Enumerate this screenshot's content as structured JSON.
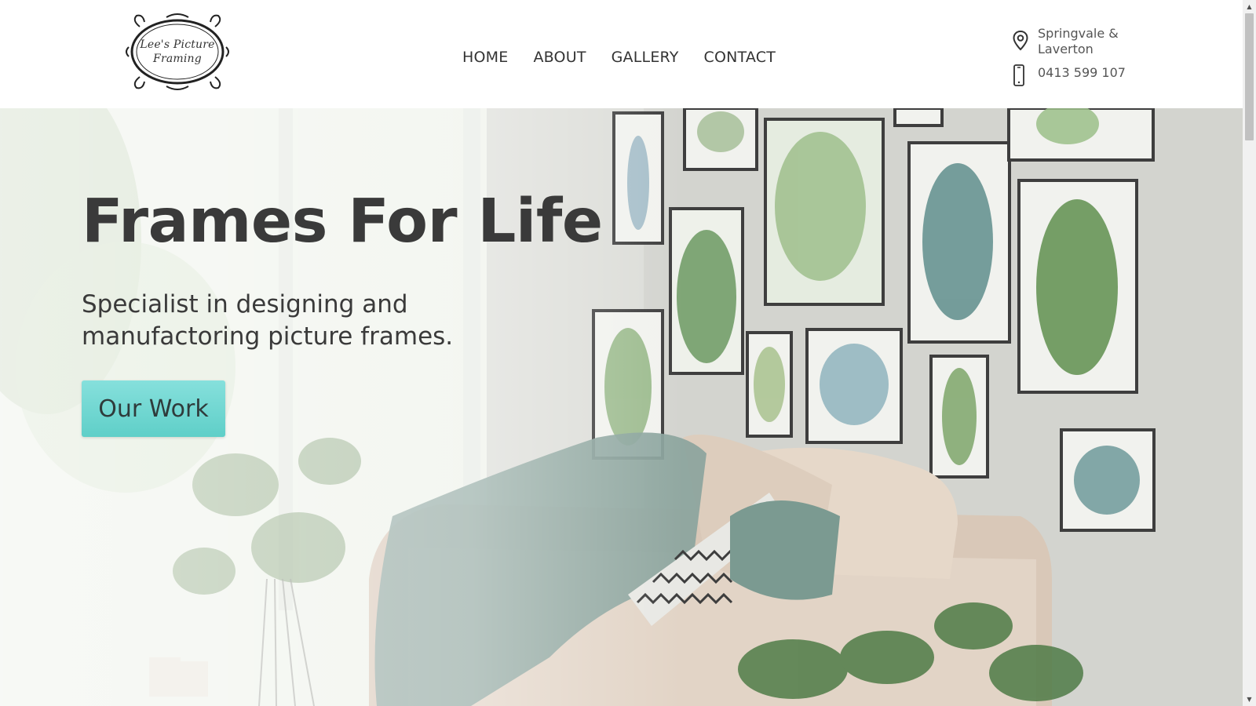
{
  "logo": {
    "line1": "Lee's Picture",
    "line2": "Framing"
  },
  "nav": {
    "items": [
      {
        "label": "HOME"
      },
      {
        "label": "ABOUT"
      },
      {
        "label": "GALLERY"
      },
      {
        "label": "CONTACT"
      }
    ]
  },
  "contact": {
    "location": "Springvale & Laverton",
    "phone": "0413 599 107",
    "location_icon": "map-pin-icon",
    "phone_icon": "mobile-phone-icon"
  },
  "hero": {
    "title": "Frames For Life",
    "subtitle": "Specialist in designing and manufactoring picture frames.",
    "cta_label": "Our Work"
  },
  "colors": {
    "accent": "#66d3cc",
    "text_dark": "#3a3a3a",
    "header_bg": "#ffffff"
  }
}
